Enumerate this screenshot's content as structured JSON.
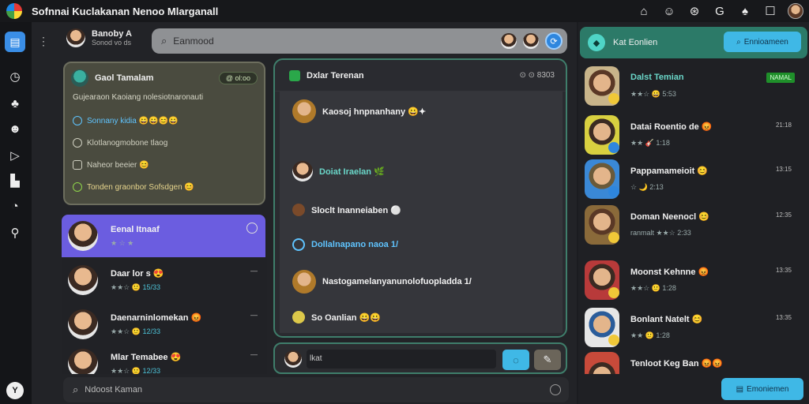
{
  "app": {
    "title": "Sofnnai Kuclakanan Nenoo Mlarganall"
  },
  "titlebar_icons": [
    "home-icon",
    "user-icon",
    "settings-icon",
    "google-icon",
    "notification-icon",
    "window-icon",
    "profile-avatar"
  ],
  "leftbar": {
    "icons": [
      "sidebar-home-icon",
      "clock-icon",
      "groups-icon",
      "emoji-icon",
      "play-icon",
      "store-icon",
      "activity-icon",
      "key-icon"
    ],
    "bottom_label": "Y"
  },
  "profile": {
    "name": "Banoby A",
    "sub": "Sonod vo ds"
  },
  "search_top": {
    "placeholder": "Eanmood"
  },
  "group_card": {
    "title": "Gaol Tamalam",
    "badge": "@ ol:oo",
    "subtitle": "Gujearaon Kaoiang nolesiotnaronauti",
    "items": [
      {
        "text": "Sonnany kidia 😀😀😊😀",
        "color": "#5fc4ff"
      },
      {
        "text": "Klotlanogmobone tlaog",
        "color": "#d0d0c0"
      },
      {
        "text": "Naheor beeier 😊",
        "color": "#d0d0c0"
      },
      {
        "text": "Tonden graonbor Sofsdgen 😊",
        "color": "#e6d48c"
      }
    ]
  },
  "chat_list": [
    {
      "name": "Eenal Itnaaf",
      "meta": "★ ☆ ★",
      "num": "",
      "active": true
    },
    {
      "name": "Daar lor s 😍",
      "meta": "★★☆ 🙂",
      "num": "15/33"
    },
    {
      "name": "Daenarninlomekan 😡",
      "meta": "★★☆ 🙂",
      "num": "12/33"
    },
    {
      "name": "Mlar Temabee 😍",
      "meta": "★★☆ 🙂",
      "num": "12/33"
    }
  ],
  "chat_panel": {
    "title": "Dxlar Terenan",
    "right": "⊙ ⊙ 8303",
    "messages": [
      {
        "text": "Kaosoj hnpnanhany 😀✦",
        "style": ""
      },
      {
        "text": "Doiat Iraelan 🌿",
        "style": "teal"
      },
      {
        "text": "Sloclt Inanneiaben ⚪",
        "style": ""
      },
      {
        "text": "Dollalnapano naoa 1/",
        "style": "blue"
      },
      {
        "text": "Nastogamelanyanunolofuopladda 1/",
        "style": ""
      },
      {
        "text": "So Oanlian 😀😀",
        "style": ""
      }
    ]
  },
  "composer": {
    "text": "lkat"
  },
  "bottom_search": {
    "placeholder": "Ndoost Kaman"
  },
  "friends_panel": {
    "title": "Kat Eonlien",
    "button": "Ennioameen",
    "friends": [
      {
        "name": "Dalst Temian",
        "sub": "★★☆ 😀 5:53",
        "tag": "NAMAL",
        "tagtype": "green"
      },
      {
        "name": "Datai Roentio de 😡",
        "sub": "★★ 🎸 1:18",
        "tag": "21:18",
        "tagtype": "min"
      },
      {
        "name": "Pappamameioit 😊",
        "sub": "☆ 🌙 2:13",
        "tag": "13:15",
        "tagtype": "min"
      },
      {
        "name": "Doman Neenocl 😊",
        "sub": "ranmalt ★★☆ 2:33",
        "tag": "12:35",
        "tagtype": "min"
      },
      {
        "name": "Moonst Kehnne 😡",
        "sub": "★★☆ 🙂 1:28",
        "tag": "13:35",
        "tagtype": "min"
      },
      {
        "name": "Bonlant Natelt 😊",
        "sub": "★★ 🙂 1:28",
        "tag": "13:35",
        "tagtype": "min"
      },
      {
        "name": "Tenloot Keg Ban 😡😡",
        "sub": "",
        "tag": "",
        "tagtype": ""
      }
    ],
    "bottom_button": "Emoniemen"
  }
}
